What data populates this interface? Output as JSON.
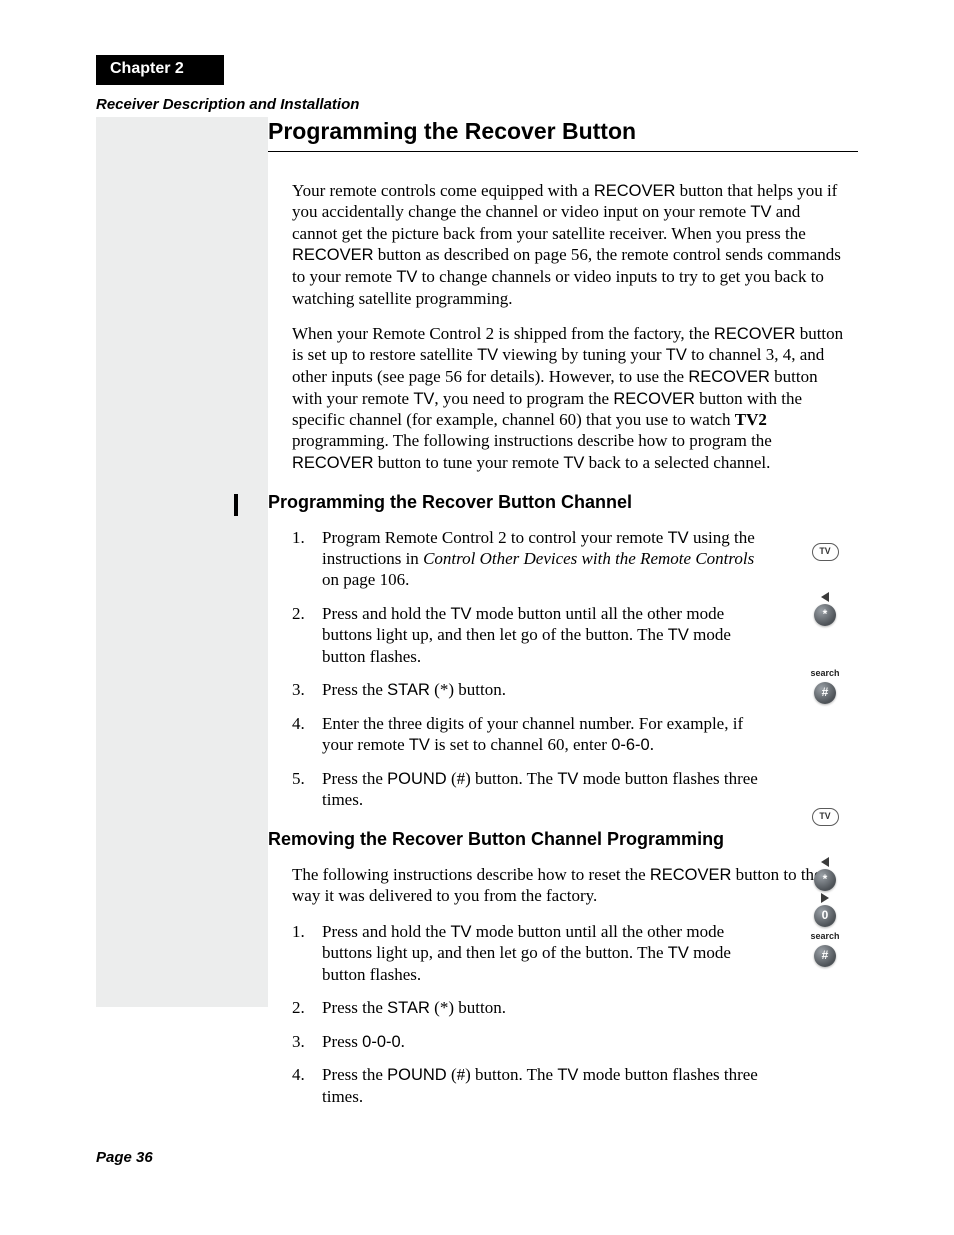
{
  "chapter": "Chapter 2",
  "breadcrumb": "Receiver Description and Installation",
  "title": "Programming the Recover Button",
  "intro": [
    "Your remote controls come equipped with a RECOVER button that helps you if you accidentally change the channel or video input on your remote TV and cannot get the picture back from your satellite receiver. When you press the RECOVER button as described on page 56, the remote control sends commands to your remote TV to change channels or video inputs to try to get you back to watching satellite programming.",
    "When your Remote Control 2 is shipped from the factory, the RECOVER button is set up to restore satellite TV viewing by tuning your TV to channel 3, 4, and other inputs (see page 56 for details). However, to use the RECOVER button with your remote TV, you need to program the RECOVER button with the specific channel (for example, channel 60) that you use to watch TV2 programming. The following instructions describe how to program the RECOVER button to tune your remote TV back to a selected channel."
  ],
  "section_a": {
    "heading": "Programming the Recover Button Channel",
    "steps": [
      "Program Remote Control 2 to control your remote TV using the instructions in Control Other Devices with the Remote Controls on page 106.",
      "Press and hold the TV mode button until all the other mode buttons light up, and then let go of the button. The TV mode button flashes.",
      "Press the STAR (*) button.",
      "Enter the three digits of your channel number. For example, if your remote TV is set to channel 60, enter 0-6-0.",
      "Press the POUND (#) button. The TV mode button flashes three times."
    ]
  },
  "section_b": {
    "heading": "Removing the Recover Button Channel Programming",
    "intro": "The following instructions describe how to reset the RECOVER button to the way it was delivered to you from the factory.",
    "steps": [
      "Press and hold the TV mode button until all the other mode buttons light up, and then let go of the button. The TV mode button flashes.",
      "Press the STAR (*) button.",
      "Press 0-0-0.",
      "Press the POUND (#) button. The TV mode button flashes three times."
    ]
  },
  "page_number": "Page 36",
  "icons": {
    "tv": "TV",
    "star": "*",
    "pound": "#",
    "zero": "0",
    "search": "search"
  }
}
